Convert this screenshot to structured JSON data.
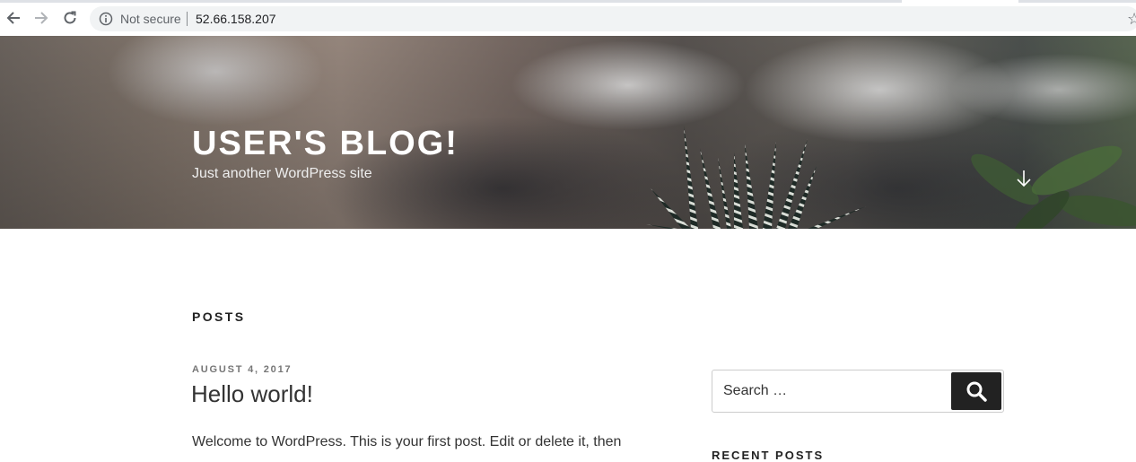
{
  "browser": {
    "security_label": "Not secure",
    "url": "52.66.158.207"
  },
  "site": {
    "title": "USER'S BLOG!",
    "description": "Just another WordPress site"
  },
  "main": {
    "section_title": "POSTS",
    "post": {
      "date": "AUGUST 4, 2017",
      "title": "Hello world!",
      "excerpt": "Welcome to WordPress. This is your first post. Edit or delete it, then"
    }
  },
  "sidebar": {
    "search_placeholder": "Search …",
    "recent_posts_heading": "RECENT POSTS"
  }
}
